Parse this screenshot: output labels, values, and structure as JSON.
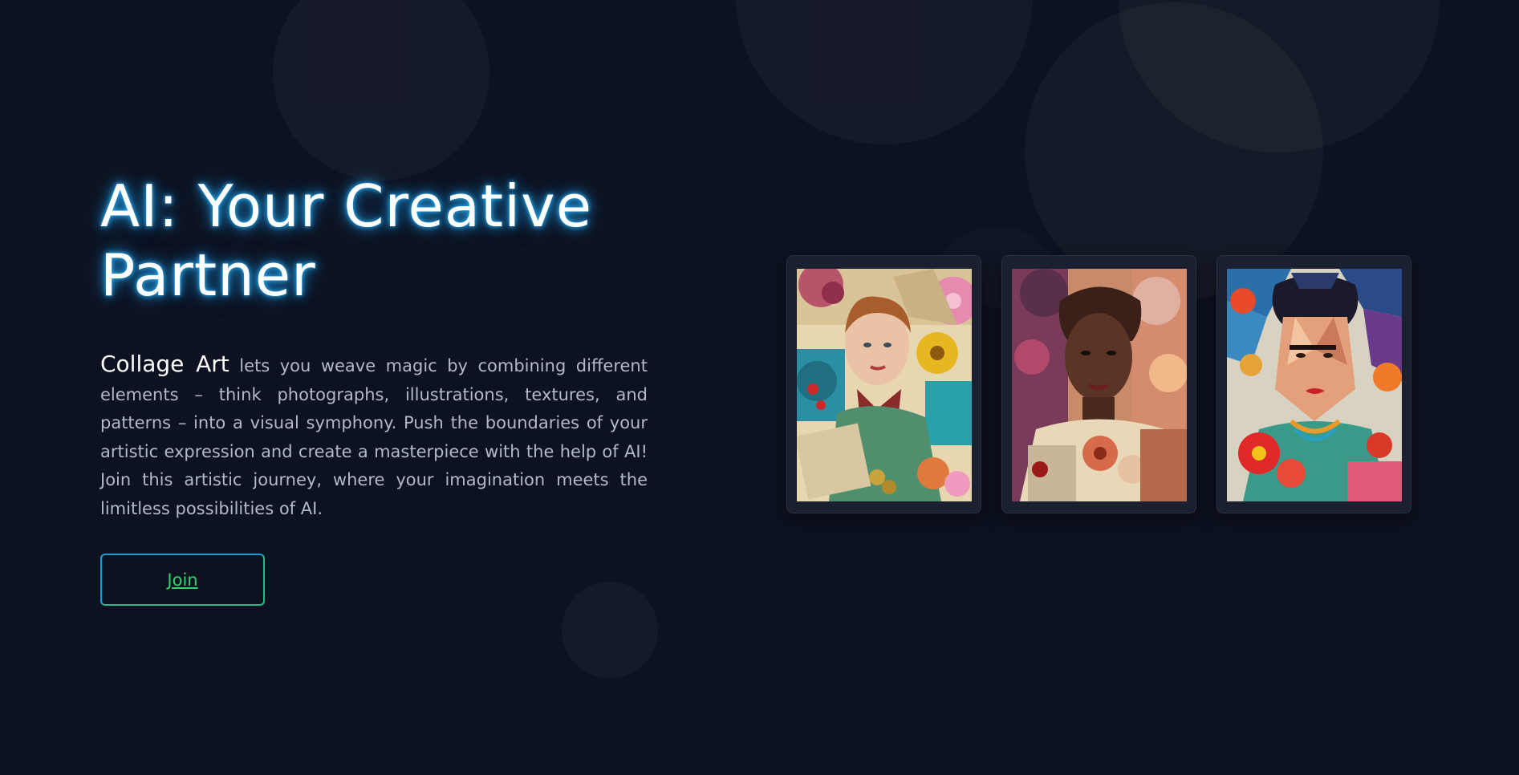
{
  "hero": {
    "title": "AI: Your Creative Partner",
    "highlight": "Collage Art",
    "description": " lets you weave magic by combining different elements – think photographs, illustrations, textures, and patterns – into a visual symphony. Push the boundaries of your artistic expression and create a masterpiece with the help of AI! Join this artistic journey, where your imagination meets the limitless possibilities of AI.",
    "join_label": "Join"
  },
  "gallery": {
    "items": [
      {
        "subject": "woman-portrait-collage-art"
      },
      {
        "subject": "woman-portrait-collage-art"
      },
      {
        "subject": "frida-portrait-collage-art"
      }
    ]
  },
  "colors": {
    "background": "#0d1221",
    "title_glow": "#29b6ff",
    "join_text": "#2ed36a",
    "join_border": "#1fbf8a",
    "card_background": "#1b2030"
  }
}
